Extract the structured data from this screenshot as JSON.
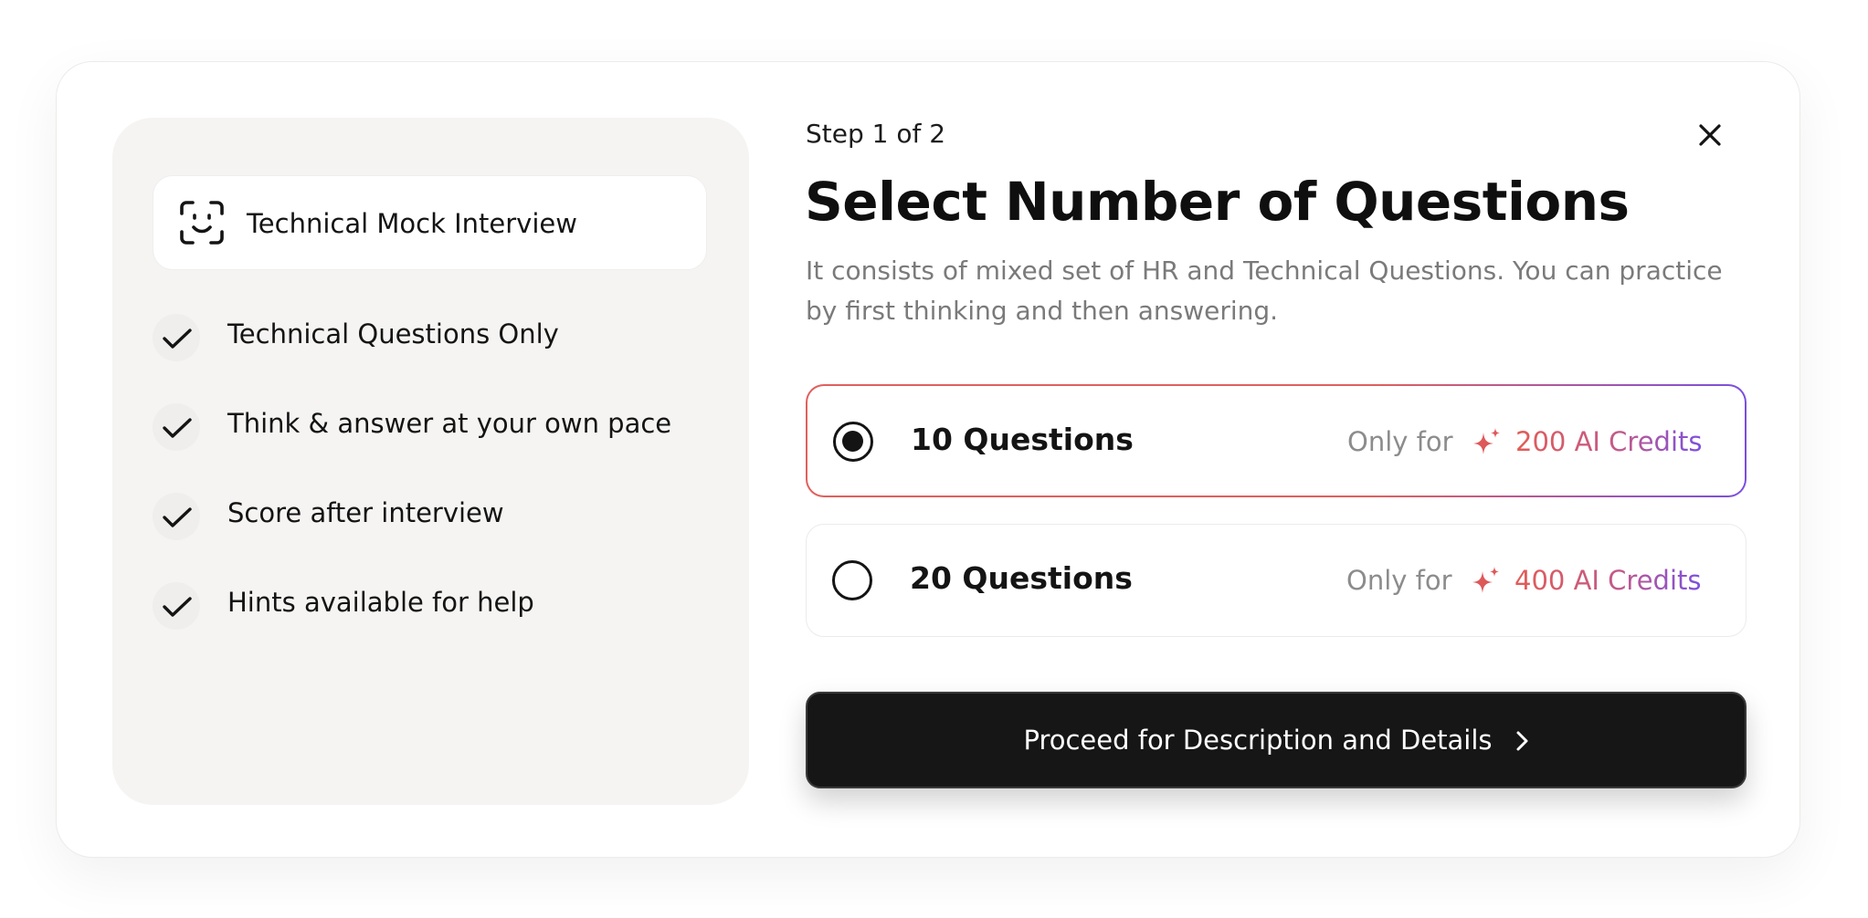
{
  "left_panel": {
    "interview_title": "Technical Mock Interview",
    "interview_icon": "face-scan-icon",
    "features": [
      "Technical Questions Only",
      "Think & answer at your own pace",
      "Score after interview",
      "Hints available for help"
    ],
    "feature_icon": "check-icon"
  },
  "header": {
    "step": "Step 1 of 2",
    "title": "Select Number of Questions",
    "subtitle": "It consists of mixed set of HR and Technical Questions. You can practice by first thinking and then answering.",
    "close_icon": "close-icon"
  },
  "options": [
    {
      "label": "10 Questions",
      "only_for": "Only for",
      "credits": "200 AI Credits",
      "selected": true
    },
    {
      "label": "20 Questions",
      "only_for": "Only for",
      "credits": "400 AI Credits",
      "selected": false
    }
  ],
  "proceed_button": {
    "label": "Proceed for Description and Details",
    "icon": "chevron-right-icon"
  },
  "colors": {
    "selected_border_start": "#e0605c",
    "selected_border_end": "#7a4fe0",
    "credits_start": "#e25c55",
    "credits_end": "#7b4fe0",
    "button_bg": "#161616",
    "panel_bg": "#f5f4f2"
  }
}
